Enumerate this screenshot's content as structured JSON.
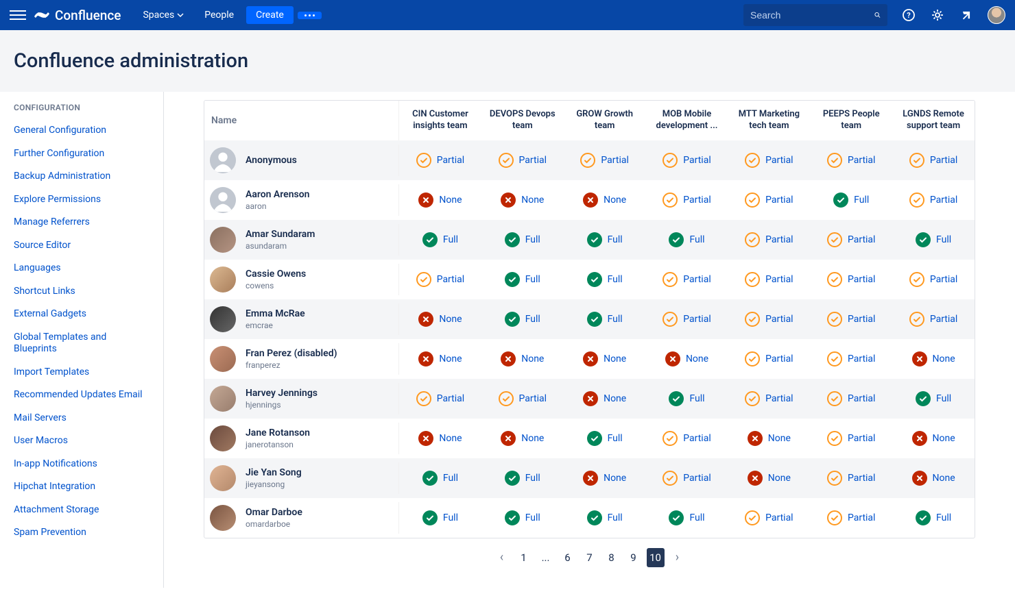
{
  "nav": {
    "brand": "Confluence",
    "spaces": "Spaces",
    "people": "People",
    "create": "Create",
    "search_placeholder": "Search"
  },
  "header": {
    "title": "Confluence administration"
  },
  "sidebar": {
    "heading": "CONFIGURATION",
    "items": [
      "General Configuration",
      "Further Configuration",
      "Backup Administration",
      "Explore Permissions",
      "Manage Referrers",
      "Source Editor",
      "Languages",
      "Shortcut Links",
      "External Gadgets",
      "Global Templates and Blueprints",
      "Import Templates",
      "Recommended Updates Email",
      "Mail Servers",
      "User Macros",
      "In-app Notifications",
      "Hipchat Integration",
      "Attachment Storage",
      "Spam Prevention"
    ]
  },
  "table": {
    "name_header": "Name",
    "columns": [
      "CIN Customer insights team",
      "DEVOPS Devops team",
      "GROW Growth team",
      "MOB Mobile development ...",
      "MTT Marketing tech team",
      "PEEPS People team",
      "LGNDS Remote support team"
    ],
    "rows": [
      {
        "name": "Anonymous",
        "handle": "",
        "avatar": "default",
        "perms": [
          "Partial",
          "Partial",
          "Partial",
          "Partial",
          "Partial",
          "Partial",
          "Partial"
        ]
      },
      {
        "name": "Aaron Arenson",
        "handle": "aaron",
        "avatar": "default",
        "perms": [
          "None",
          "None",
          "None",
          "Partial",
          "Partial",
          "Full",
          "Partial"
        ]
      },
      {
        "name": "Amar Sundaram",
        "handle": "asundaram",
        "avatar": "photo",
        "perms": [
          "Full",
          "Full",
          "Full",
          "Full",
          "Partial",
          "Partial",
          "Full"
        ]
      },
      {
        "name": "Cassie Owens",
        "handle": "cowens",
        "avatar": "p2",
        "perms": [
          "Partial",
          "Full",
          "Full",
          "Partial",
          "Partial",
          "Partial",
          "Partial"
        ]
      },
      {
        "name": "Emma McRae",
        "handle": "emcrae",
        "avatar": "p3",
        "perms": [
          "None",
          "Full",
          "Full",
          "Partial",
          "Partial",
          "Partial",
          "Partial"
        ]
      },
      {
        "name": "Fran Perez (disabled)",
        "handle": "franperez",
        "avatar": "p4",
        "perms": [
          "None",
          "None",
          "None",
          "None",
          "Partial",
          "Partial",
          "None"
        ]
      },
      {
        "name": "Harvey Jennings",
        "handle": "hjennings",
        "avatar": "p5",
        "perms": [
          "Partial",
          "Partial",
          "None",
          "Full",
          "Partial",
          "Partial",
          "Full"
        ]
      },
      {
        "name": "Jane Rotanson",
        "handle": "janerotanson",
        "avatar": "p6",
        "perms": [
          "None",
          "None",
          "Full",
          "Partial",
          "None",
          "Partial",
          "None"
        ]
      },
      {
        "name": "Jie Yan Song",
        "handle": "jieyansong",
        "avatar": "p7",
        "perms": [
          "Full",
          "Full",
          "None",
          "Partial",
          "None",
          "Partial",
          "None"
        ]
      },
      {
        "name": "Omar Darboe",
        "handle": "omardarboe",
        "avatar": "p8",
        "perms": [
          "Full",
          "Full",
          "Full",
          "Full",
          "Partial",
          "Partial",
          "Full"
        ]
      }
    ]
  },
  "perm_labels": {
    "Full": "Full",
    "None": "None",
    "Partial": "Partial"
  },
  "pager": {
    "pages": [
      "1",
      "...",
      "6",
      "7",
      "8",
      "9",
      "10"
    ],
    "active": "10"
  }
}
